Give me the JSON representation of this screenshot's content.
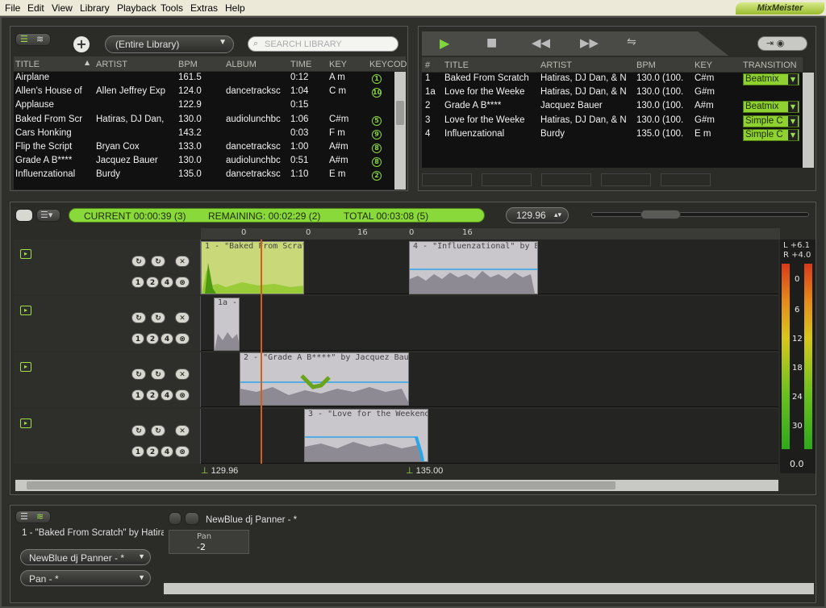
{
  "menu": {
    "items": [
      "File",
      "Edit",
      "View",
      "Library",
      "Playback",
      "Tools",
      "Extras",
      "Help"
    ],
    "brand": "MixMeister"
  },
  "library": {
    "scope": "(Entire Library)",
    "search_placeholder": "SEARCH LIBRARY",
    "columns": [
      "TITLE",
      "ARTIST",
      "BPM",
      "ALBUM",
      "TIME",
      "KEY",
      "KEYCODE"
    ],
    "rows": [
      {
        "title": "Airplane",
        "artist": "",
        "bpm": "161.5",
        "album": "",
        "time": "0:12",
        "key": "A m",
        "code": "1"
      },
      {
        "title": "Allen's House of",
        "artist": "Allen Jeffrey Exp",
        "bpm": "124.0",
        "album": "dancetracksc",
        "time": "1:04",
        "key": "C m",
        "code": "10"
      },
      {
        "title": "Applause",
        "artist": "",
        "bpm": "122.9",
        "album": "",
        "time": "0:15",
        "key": "",
        "code": ""
      },
      {
        "title": "Baked From Scr",
        "artist": "Hatiras, DJ Dan,",
        "bpm": "130.0",
        "album": "audiolunchbc",
        "time": "1:06",
        "key": "C#m",
        "code": "5"
      },
      {
        "title": "Cars Honking",
        "artist": "",
        "bpm": "143.2",
        "album": "",
        "time": "0:03",
        "key": "F m",
        "code": "9"
      },
      {
        "title": "Flip the Script",
        "artist": "Bryan Cox",
        "bpm": "133.0",
        "album": "dancetracksc",
        "time": "1:00",
        "key": "A#m",
        "code": "8"
      },
      {
        "title": "Grade A B****",
        "artist": "Jacquez Bauer",
        "bpm": "130.0",
        "album": "audiolunchbc",
        "time": "0:51",
        "key": "A#m",
        "code": "8"
      },
      {
        "title": "Influenzational",
        "artist": "Burdy",
        "bpm": "135.0",
        "album": "dancetracksc",
        "time": "1:10",
        "key": "E m",
        "code": "2"
      }
    ]
  },
  "playlist": {
    "columns": [
      "#",
      "TITLE",
      "ARTIST",
      "BPM",
      "KEY",
      "TRANSITION"
    ],
    "rows": [
      {
        "num": "1",
        "title": "Baked From Scratch",
        "artist": "Hatiras, DJ Dan, & N",
        "bpm": "130.0 (100.",
        "key": "C#m",
        "trans": "Beatmix"
      },
      {
        "num": "1a",
        "title": "Love for the Weeke",
        "artist": "Hatiras, DJ Dan, & N",
        "bpm": "130.0 (100.",
        "key": "G#m",
        "trans": ""
      },
      {
        "num": "2",
        "title": "Grade A B****",
        "artist": "Jacquez Bauer",
        "bpm": "130.0 (100.",
        "key": "A#m",
        "trans": "Beatmix"
      },
      {
        "num": "3",
        "title": "Love for the Weeke",
        "artist": "Hatiras, DJ Dan, & N",
        "bpm": "130.0 (100.",
        "key": "G#m",
        "trans": "Simple C"
      },
      {
        "num": "4",
        "title": "Influenzational",
        "artist": "Burdy",
        "bpm": "135.0 (100.",
        "key": "E m",
        "trans": "Simple C"
      }
    ]
  },
  "status": {
    "current": "CURRENT 00:00:39 (3)",
    "remaining": "REMAINING: 00:02:29 (2)",
    "total": "TOTAL 00:03:08 (5)",
    "bpm": "129.96"
  },
  "timeline": {
    "ruler": [
      "0",
      "0",
      "16",
      "0",
      "16"
    ],
    "bpm_markers": [
      "129.96",
      "135.00"
    ],
    "clips": [
      "1 - \"Baked From Scratch\" by Hatiras",
      "4 - \"Influenzational\" by Burdy",
      "1a - ",
      "2 - \"Grade A B****\" by Jacquez Bauer",
      "3 - \"Love for the Weekend\""
    ],
    "loop_buttons": [
      "1",
      "2",
      "4",
      "8"
    ]
  },
  "meter": {
    "L": "L +6.1",
    "R": "R +4.0",
    "scale": [
      "0",
      "6",
      "12",
      "18",
      "24",
      "30"
    ],
    "value": "0.0"
  },
  "effects": {
    "track": "1 - \"Baked From Scratch\" by Hatiras",
    "effect": "NewBlue dj Panner - *",
    "param": "Pan - *",
    "title": "NewBlue dj Panner - *",
    "pan_label": "Pan",
    "pan_value": "-2"
  }
}
